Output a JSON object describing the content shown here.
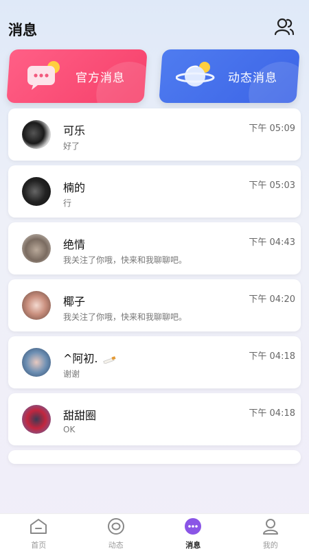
{
  "header": {
    "title": "消息",
    "contacts_icon": "contacts-icon"
  },
  "cards": {
    "official": {
      "label": "官方消息",
      "icon": "chat-bubble-icon",
      "color": "#f6406a"
    },
    "dynamic": {
      "label": "动态消息",
      "icon": "planet-icon",
      "color": "#3c64e6"
    }
  },
  "conversations": [
    {
      "name": "可乐",
      "preview": "好了",
      "time": "下午 05:09"
    },
    {
      "name": "楠的",
      "preview": "行",
      "time": "下午 05:03"
    },
    {
      "name": "绝情",
      "preview": "我关注了你哦，快来和我聊聊吧。",
      "time": "下午 04:43"
    },
    {
      "name": "椰子",
      "preview": "我关注了你哦，快来和我聊聊吧。",
      "time": "下午 04:20"
    },
    {
      "name": "^阿初.",
      "preview": "谢谢",
      "time": "下午 04:18"
    },
    {
      "name": "甜甜圈",
      "preview": "OK",
      "time": "下午 04:18"
    }
  ],
  "tabbar": {
    "home": {
      "label": "首页",
      "icon": "home-icon"
    },
    "dynamic": {
      "label": "动态",
      "icon": "circle-eye-icon"
    },
    "messages": {
      "label": "消息",
      "icon": "message-bubble-icon",
      "active": true,
      "color": "#8a55e6"
    },
    "mine": {
      "label": "我的",
      "icon": "person-icon"
    }
  }
}
